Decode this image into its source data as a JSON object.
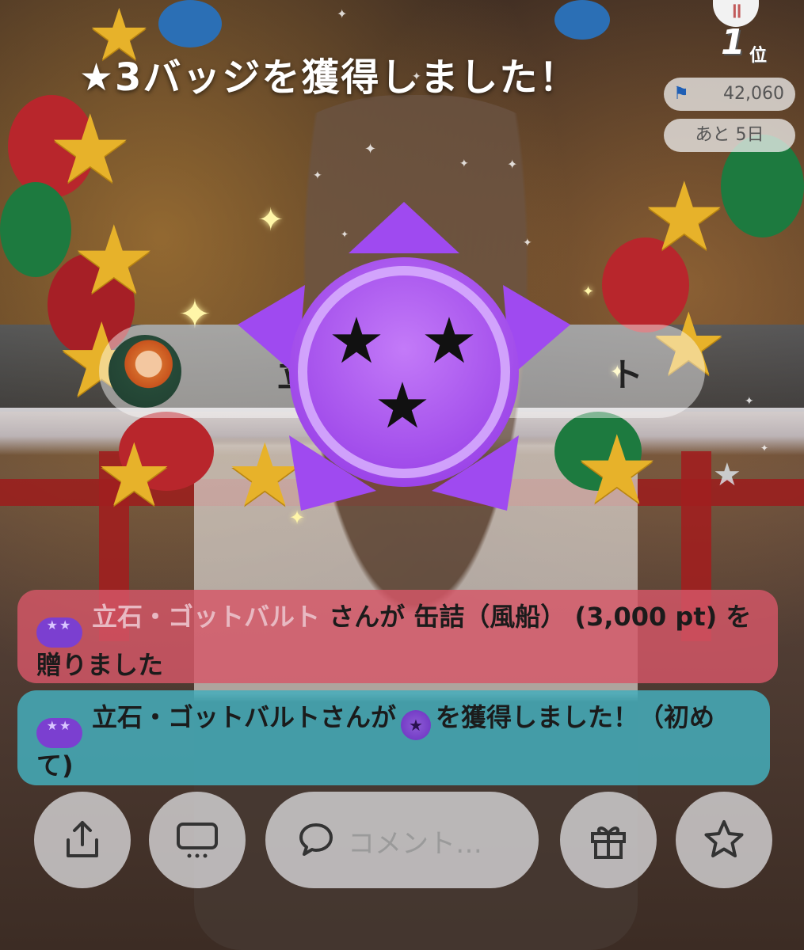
{
  "overlay_title": "★3バッジを獲得しました！",
  "stats": {
    "rank_number": "1",
    "rank_suffix": "位",
    "points": "42,060",
    "remaining": "あと 5日",
    "pause_symbol": "॥"
  },
  "banner": {
    "text": "立　　　　　　　　　ト"
  },
  "badge": {
    "stars": 3,
    "color": "#a64cf2"
  },
  "messages": [
    {
      "badge_stars": "★★",
      "name": "立石・ゴットバルト",
      "text": "さんが 缶詰（風船） (3,000 pt) を贈りました",
      "color": "#d55768"
    },
    {
      "badge_stars": "★★",
      "text_before": "立石・ゴットバルトさんが",
      "inline_badge": "★",
      "text_after": "を獲得しました！（初めて)",
      "color": "#44aebc"
    }
  ],
  "toolbar": {
    "comment_placeholder": "コメント…",
    "buttons": [
      "share-icon",
      "screen-icon",
      "gift-icon",
      "star-icon"
    ]
  }
}
